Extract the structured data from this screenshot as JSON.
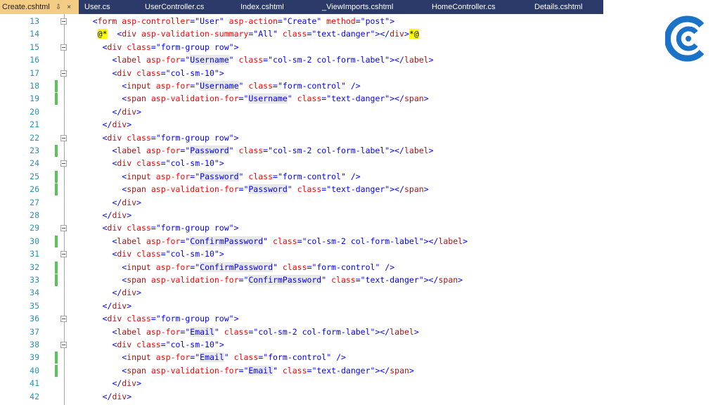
{
  "tabs": [
    {
      "label": "Create.cshtml",
      "active": true,
      "icons": [
        "pin-icon",
        "close-icon"
      ]
    },
    {
      "label": "User.cs"
    },
    {
      "label": "UserController.cs"
    },
    {
      "label": "Index.cshtml"
    },
    {
      "label": "_ViewImports.cshtml"
    },
    {
      "label": "HomeController.cs"
    },
    {
      "label": "Details.cshtml"
    }
  ],
  "tab_glyphs": {
    "pin": "⇩",
    "close": "×"
  },
  "colors": {
    "tab_bar": "#2b3a68",
    "active_tab": "#f5cc84",
    "line_number": "#2b91af",
    "tag": "#a31515",
    "attribute": "#ff0000",
    "value": "#0000ff",
    "change_marker": "#5cc15c",
    "razor_highlight": "#ffff00",
    "logo": "#1a73c9"
  },
  "logo": {
    "icon": "brand-c-logo"
  },
  "lines": [
    {
      "num": "13",
      "fold": true,
      "indent": 4,
      "tokens": [
        [
          "p",
          "<"
        ],
        [
          "t",
          "form"
        ],
        [
          "s",
          " "
        ],
        [
          "a",
          "asp-controller"
        ],
        [
          "p",
          "="
        ],
        [
          "v",
          "\"User\""
        ],
        [
          "s",
          " "
        ],
        [
          "a",
          "asp-action"
        ],
        [
          "p",
          "="
        ],
        [
          "v",
          "\"Create\""
        ],
        [
          "s",
          " "
        ],
        [
          "a",
          "method"
        ],
        [
          "p",
          "="
        ],
        [
          "v",
          "\"post\""
        ],
        [
          "p",
          ">"
        ]
      ]
    },
    {
      "num": "14",
      "indent": 5,
      "tokens": [
        [
          "rz",
          "@*"
        ],
        [
          "s",
          "  "
        ],
        [
          "p",
          "<"
        ],
        [
          "t",
          "div"
        ],
        [
          "s",
          " "
        ],
        [
          "a",
          "asp-validation-summary"
        ],
        [
          "p",
          "="
        ],
        [
          "v",
          "\"All\""
        ],
        [
          "s",
          " "
        ],
        [
          "a",
          "class"
        ],
        [
          "p",
          "="
        ],
        [
          "v",
          "\"text-danger\""
        ],
        [
          "p",
          "></"
        ],
        [
          "t",
          "div"
        ],
        [
          "p",
          ">"
        ],
        [
          "rz",
          "*@"
        ]
      ]
    },
    {
      "num": "15",
      "fold": true,
      "indent": 6,
      "tokens": [
        [
          "p",
          "<"
        ],
        [
          "t",
          "div"
        ],
        [
          "s",
          " "
        ],
        [
          "a",
          "class"
        ],
        [
          "p",
          "="
        ],
        [
          "v",
          "\"form-group row\""
        ],
        [
          "p",
          ">"
        ]
      ]
    },
    {
      "num": "16",
      "indent": 8,
      "tokens": [
        [
          "p",
          "<"
        ],
        [
          "t",
          "label"
        ],
        [
          "s",
          " "
        ],
        [
          "a",
          "asp-for"
        ],
        [
          "p",
          "="
        ],
        [
          "v",
          "\""
        ],
        [
          "hl",
          "Username"
        ],
        [
          "v",
          "\""
        ],
        [
          "s",
          " "
        ],
        [
          "a",
          "class"
        ],
        [
          "p",
          "="
        ],
        [
          "v",
          "\"col-sm-2 col-form-label\""
        ],
        [
          "p",
          "></"
        ],
        [
          "t",
          "label"
        ],
        [
          "p",
          ">"
        ]
      ]
    },
    {
      "num": "17",
      "fold": true,
      "indent": 8,
      "tokens": [
        [
          "p",
          "<"
        ],
        [
          "t",
          "div"
        ],
        [
          "s",
          " "
        ],
        [
          "a",
          "class"
        ],
        [
          "p",
          "="
        ],
        [
          "v",
          "\"col-sm-10\""
        ],
        [
          "p",
          ">"
        ]
      ]
    },
    {
      "num": "18",
      "changed": true,
      "indent": 10,
      "tokens": [
        [
          "p",
          "<"
        ],
        [
          "t",
          "input"
        ],
        [
          "s",
          " "
        ],
        [
          "a",
          "asp-for"
        ],
        [
          "p",
          "="
        ],
        [
          "v",
          "\""
        ],
        [
          "hl",
          "Username"
        ],
        [
          "v",
          "\""
        ],
        [
          "s",
          " "
        ],
        [
          "a",
          "class"
        ],
        [
          "p",
          "="
        ],
        [
          "v",
          "\"form-control\""
        ],
        [
          "s",
          " "
        ],
        [
          "p",
          "/>"
        ]
      ]
    },
    {
      "num": "19",
      "changed": true,
      "indent": 10,
      "tokens": [
        [
          "p",
          "<"
        ],
        [
          "t",
          "span"
        ],
        [
          "s",
          " "
        ],
        [
          "a",
          "asp-validation-for"
        ],
        [
          "p",
          "="
        ],
        [
          "v",
          "\""
        ],
        [
          "hl",
          "Username"
        ],
        [
          "v",
          "\""
        ],
        [
          "s",
          " "
        ],
        [
          "a",
          "class"
        ],
        [
          "p",
          "="
        ],
        [
          "v",
          "\"text-danger\""
        ],
        [
          "p",
          "></"
        ],
        [
          "t",
          "span"
        ],
        [
          "p",
          ">"
        ]
      ]
    },
    {
      "num": "20",
      "indent": 8,
      "tokens": [
        [
          "p",
          "</"
        ],
        [
          "t",
          "div"
        ],
        [
          "p",
          ">"
        ]
      ]
    },
    {
      "num": "21",
      "indent": 6,
      "tokens": [
        [
          "p",
          "</"
        ],
        [
          "t",
          "div"
        ],
        [
          "p",
          ">"
        ]
      ]
    },
    {
      "num": "22",
      "fold": true,
      "indent": 6,
      "tokens": [
        [
          "p",
          "<"
        ],
        [
          "t",
          "div"
        ],
        [
          "s",
          " "
        ],
        [
          "a",
          "class"
        ],
        [
          "p",
          "="
        ],
        [
          "v",
          "\"form-group row\""
        ],
        [
          "p",
          ">"
        ]
      ]
    },
    {
      "num": "23",
      "changed": true,
      "indent": 8,
      "tokens": [
        [
          "p",
          "<"
        ],
        [
          "t",
          "label"
        ],
        [
          "s",
          " "
        ],
        [
          "a",
          "asp-for"
        ],
        [
          "p",
          "="
        ],
        [
          "v",
          "\""
        ],
        [
          "hl",
          "Password"
        ],
        [
          "v",
          "\""
        ],
        [
          "s",
          " "
        ],
        [
          "a",
          "class"
        ],
        [
          "p",
          "="
        ],
        [
          "v",
          "\"col-sm-2 col-form-label\""
        ],
        [
          "p",
          "></"
        ],
        [
          "t",
          "label"
        ],
        [
          "p",
          ">"
        ]
      ]
    },
    {
      "num": "24",
      "fold": true,
      "indent": 8,
      "tokens": [
        [
          "p",
          "<"
        ],
        [
          "t",
          "div"
        ],
        [
          "s",
          " "
        ],
        [
          "a",
          "class"
        ],
        [
          "p",
          "="
        ],
        [
          "v",
          "\"col-sm-10\""
        ],
        [
          "p",
          ">"
        ]
      ]
    },
    {
      "num": "25",
      "changed": true,
      "indent": 10,
      "tokens": [
        [
          "p",
          "<"
        ],
        [
          "t",
          "input"
        ],
        [
          "s",
          " "
        ],
        [
          "a",
          "asp-for"
        ],
        [
          "p",
          "="
        ],
        [
          "v",
          "\""
        ],
        [
          "hl",
          "Password"
        ],
        [
          "v",
          "\""
        ],
        [
          "s",
          " "
        ],
        [
          "a",
          "class"
        ],
        [
          "p",
          "="
        ],
        [
          "v",
          "\"form-control\""
        ],
        [
          "s",
          " "
        ],
        [
          "p",
          "/>"
        ]
      ]
    },
    {
      "num": "26",
      "changed": true,
      "indent": 10,
      "tokens": [
        [
          "p",
          "<"
        ],
        [
          "t",
          "span"
        ],
        [
          "s",
          " "
        ],
        [
          "a",
          "asp-validation-for"
        ],
        [
          "p",
          "="
        ],
        [
          "v",
          "\""
        ],
        [
          "hl",
          "Password"
        ],
        [
          "v",
          "\""
        ],
        [
          "s",
          " "
        ],
        [
          "a",
          "class"
        ],
        [
          "p",
          "="
        ],
        [
          "v",
          "\"text-danger\""
        ],
        [
          "p",
          "></"
        ],
        [
          "t",
          "span"
        ],
        [
          "p",
          ">"
        ]
      ]
    },
    {
      "num": "27",
      "indent": 8,
      "tokens": [
        [
          "p",
          "</"
        ],
        [
          "t",
          "div"
        ],
        [
          "p",
          ">"
        ]
      ]
    },
    {
      "num": "28",
      "indent": 6,
      "tokens": [
        [
          "p",
          "</"
        ],
        [
          "t",
          "div"
        ],
        [
          "p",
          ">"
        ]
      ]
    },
    {
      "num": "29",
      "fold": true,
      "indent": 6,
      "tokens": [
        [
          "p",
          "<"
        ],
        [
          "t",
          "div"
        ],
        [
          "s",
          " "
        ],
        [
          "a",
          "class"
        ],
        [
          "p",
          "="
        ],
        [
          "v",
          "\"form-group row\""
        ],
        [
          "p",
          ">"
        ]
      ]
    },
    {
      "num": "30",
      "changed": true,
      "indent": 8,
      "tokens": [
        [
          "p",
          "<"
        ],
        [
          "t",
          "label"
        ],
        [
          "s",
          " "
        ],
        [
          "a",
          "asp-for"
        ],
        [
          "p",
          "="
        ],
        [
          "v",
          "\""
        ],
        [
          "hl",
          "ConfirmPassword"
        ],
        [
          "v",
          "\""
        ],
        [
          "s",
          " "
        ],
        [
          "a",
          "class"
        ],
        [
          "p",
          "="
        ],
        [
          "v",
          "\"col-sm-2 col-form-label\""
        ],
        [
          "p",
          "></"
        ],
        [
          "t",
          "label"
        ],
        [
          "p",
          ">"
        ]
      ]
    },
    {
      "num": "31",
      "fold": true,
      "indent": 8,
      "tokens": [
        [
          "p",
          "<"
        ],
        [
          "t",
          "div"
        ],
        [
          "s",
          " "
        ],
        [
          "a",
          "class"
        ],
        [
          "p",
          "="
        ],
        [
          "v",
          "\"col-sm-10\""
        ],
        [
          "p",
          ">"
        ]
      ]
    },
    {
      "num": "32",
      "changed": true,
      "indent": 10,
      "tokens": [
        [
          "p",
          "<"
        ],
        [
          "t",
          "input"
        ],
        [
          "s",
          " "
        ],
        [
          "a",
          "asp-for"
        ],
        [
          "p",
          "="
        ],
        [
          "v",
          "\""
        ],
        [
          "hl",
          "ConfirmPassword"
        ],
        [
          "v",
          "\""
        ],
        [
          "s",
          " "
        ],
        [
          "a",
          "class"
        ],
        [
          "p",
          "="
        ],
        [
          "v",
          "\"form-control\""
        ],
        [
          "s",
          " "
        ],
        [
          "p",
          "/>"
        ]
      ]
    },
    {
      "num": "33",
      "changed": true,
      "indent": 10,
      "tokens": [
        [
          "p",
          "<"
        ],
        [
          "t",
          "span"
        ],
        [
          "s",
          " "
        ],
        [
          "a",
          "asp-validation-for"
        ],
        [
          "p",
          "="
        ],
        [
          "v",
          "\""
        ],
        [
          "hl",
          "ConfirmPassword"
        ],
        [
          "v",
          "\""
        ],
        [
          "s",
          " "
        ],
        [
          "a",
          "class"
        ],
        [
          "p",
          "="
        ],
        [
          "v",
          "\"text-danger\""
        ],
        [
          "p",
          "></"
        ],
        [
          "t",
          "span"
        ],
        [
          "p",
          ">"
        ]
      ]
    },
    {
      "num": "34",
      "indent": 8,
      "tokens": [
        [
          "p",
          "</"
        ],
        [
          "t",
          "div"
        ],
        [
          "p",
          ">"
        ]
      ]
    },
    {
      "num": "35",
      "indent": 6,
      "tokens": [
        [
          "p",
          "</"
        ],
        [
          "t",
          "div"
        ],
        [
          "p",
          ">"
        ]
      ]
    },
    {
      "num": "36",
      "fold": true,
      "indent": 6,
      "tokens": [
        [
          "p",
          "<"
        ],
        [
          "t",
          "div"
        ],
        [
          "s",
          " "
        ],
        [
          "a",
          "class"
        ],
        [
          "p",
          "="
        ],
        [
          "v",
          "\"form-group row\""
        ],
        [
          "p",
          ">"
        ]
      ]
    },
    {
      "num": "37",
      "indent": 8,
      "tokens": [
        [
          "p",
          "<"
        ],
        [
          "t",
          "label"
        ],
        [
          "s",
          " "
        ],
        [
          "a",
          "asp-for"
        ],
        [
          "p",
          "="
        ],
        [
          "v",
          "\""
        ],
        [
          "hl",
          "Email"
        ],
        [
          "v",
          "\""
        ],
        [
          "s",
          " "
        ],
        [
          "a",
          "class"
        ],
        [
          "p",
          "="
        ],
        [
          "v",
          "\"col-sm-2 col-form-label\""
        ],
        [
          "p",
          "></"
        ],
        [
          "t",
          "label"
        ],
        [
          "p",
          ">"
        ]
      ]
    },
    {
      "num": "38",
      "fold": true,
      "indent": 8,
      "tokens": [
        [
          "p",
          "<"
        ],
        [
          "t",
          "div"
        ],
        [
          "s",
          " "
        ],
        [
          "a",
          "class"
        ],
        [
          "p",
          "="
        ],
        [
          "v",
          "\"col-sm-10\""
        ],
        [
          "p",
          ">"
        ]
      ]
    },
    {
      "num": "39",
      "changed": true,
      "indent": 10,
      "tokens": [
        [
          "p",
          "<"
        ],
        [
          "t",
          "input"
        ],
        [
          "s",
          " "
        ],
        [
          "a",
          "asp-for"
        ],
        [
          "p",
          "="
        ],
        [
          "v",
          "\""
        ],
        [
          "hl",
          "Email"
        ],
        [
          "v",
          "\""
        ],
        [
          "s",
          " "
        ],
        [
          "a",
          "class"
        ],
        [
          "p",
          "="
        ],
        [
          "v",
          "\"form-control\""
        ],
        [
          "s",
          " "
        ],
        [
          "p",
          "/>"
        ]
      ]
    },
    {
      "num": "40",
      "changed": true,
      "indent": 10,
      "tokens": [
        [
          "p",
          "<"
        ],
        [
          "t",
          "span"
        ],
        [
          "s",
          " "
        ],
        [
          "a",
          "asp-validation-for"
        ],
        [
          "p",
          "="
        ],
        [
          "v",
          "\""
        ],
        [
          "hl",
          "Email"
        ],
        [
          "v",
          "\""
        ],
        [
          "s",
          " "
        ],
        [
          "a",
          "class"
        ],
        [
          "p",
          "="
        ],
        [
          "v",
          "\"text-danger\""
        ],
        [
          "p",
          "></"
        ],
        [
          "t",
          "span"
        ],
        [
          "p",
          ">"
        ]
      ]
    },
    {
      "num": "41",
      "indent": 8,
      "tokens": [
        [
          "p",
          "</"
        ],
        [
          "t",
          "div"
        ],
        [
          "p",
          ">"
        ]
      ]
    },
    {
      "num": "42",
      "indent": 6,
      "tokens": [
        [
          "p",
          "</"
        ],
        [
          "t",
          "div"
        ],
        [
          "p",
          ">"
        ]
      ]
    }
  ]
}
